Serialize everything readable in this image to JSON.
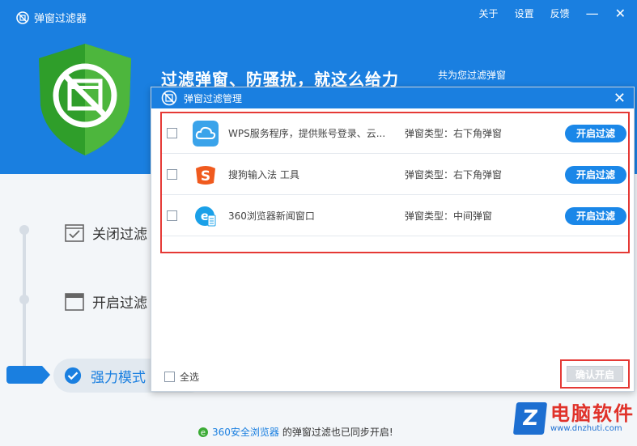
{
  "app": {
    "title": "弹窗过滤器",
    "menu": [
      "关于",
      "设置",
      "反馈"
    ],
    "minimize": "—",
    "close": "✕",
    "slogan": "过滤弹窗、防骚扰，就这么给力",
    "slogan_sub": "共为您过滤弹窗"
  },
  "modes": [
    {
      "label": "关闭过滤",
      "icon": "checkbox-window-icon"
    },
    {
      "label": "开启过滤",
      "icon": "window-icon"
    },
    {
      "label": "强力模式",
      "icon": "check-circle-icon"
    }
  ],
  "bottom_note": {
    "link": "360安全浏览器",
    "text": "的弹窗过滤也已同步开启!"
  },
  "watermark": {
    "letter": "Z",
    "title": "电脑软件",
    "url": "www.dnzhuti.com"
  },
  "dialog": {
    "title": "弹窗过滤管理",
    "close": "✕",
    "rows": [
      {
        "name": "WPS服务程序，提供账号登录、云...",
        "type": "弹窗类型：右下角弹窗",
        "button": "开启过滤",
        "icon": "cloud-icon",
        "color": "#3aa3ea"
      },
      {
        "name": "搜狗输入法 工具",
        "type": "弹窗类型：右下角弹窗",
        "button": "开启过滤",
        "icon": "sogou-icon",
        "color": "#f05a1e"
      },
      {
        "name": "360浏览器新闻窗口",
        "type": "弹窗类型：中间弹窗",
        "button": "开启过滤",
        "icon": "browser-icon",
        "color": "#1aa0e8"
      }
    ],
    "select_all": "全选",
    "confirm": "确认开启"
  },
  "colors": {
    "brand": "#1a7fe0",
    "highlight": "#e53935"
  }
}
